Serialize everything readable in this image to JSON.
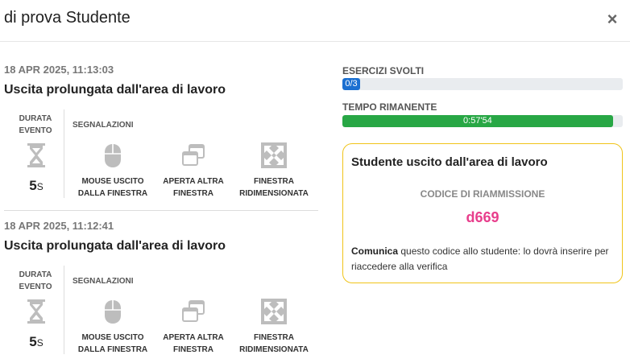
{
  "modal": {
    "title": "di prova Studente",
    "close_label": "×"
  },
  "events": [
    {
      "timestamp": "18 APR 2025, 11:13:03",
      "title": "Uscita prolungata dall'area di lavoro",
      "duration_label_line1": "DURATA",
      "duration_label_line2": "EVENTO",
      "duration_value": "5",
      "duration_unit": "S",
      "signals_label": "SEGNALAZIONI",
      "signals": [
        {
          "icon": "mouse-icon",
          "line1": "MOUSE USCITO",
          "line2": "DALLA FINESTRA"
        },
        {
          "icon": "windows-icon",
          "line1": "APERTA ALTRA",
          "line2": "FINESTRA"
        },
        {
          "icon": "resize-icon",
          "line1": "FINESTRA",
          "line2": "RIDIMENSIONATA"
        }
      ]
    },
    {
      "timestamp": "18 APR 2025, 11:12:41",
      "title": "Uscita prolungata dall'area di lavoro",
      "duration_label_line1": "DURATA",
      "duration_label_line2": "EVENTO",
      "duration_value": "5",
      "duration_unit": "S",
      "signals_label": "SEGNALAZIONI",
      "signals": [
        {
          "icon": "mouse-icon",
          "line1": "MOUSE USCITO",
          "line2": "DALLA FINESTRA"
        },
        {
          "icon": "windows-icon",
          "line1": "APERTA ALTRA",
          "line2": "FINESTRA"
        },
        {
          "icon": "resize-icon",
          "line1": "FINESTRA",
          "line2": "RIDIMENSIONATA"
        }
      ]
    }
  ],
  "progress": {
    "exercises_label": "ESERCIZI SVOLTI",
    "exercises_text": "0/3",
    "exercises_fraction": 0,
    "time_label": "TEMPO RIMANENTE",
    "time_text": "0:57'54",
    "time_fraction": 0.965
  },
  "alert_card": {
    "title": "Studente uscito dall'area di lavoro",
    "code_label": "CODICE DI RIAMMISSIONE",
    "code": "d669",
    "message_bold": "Comunica",
    "message_rest": " questo codice allo studente: lo dovrà inserire per riaccedere alla verifica"
  },
  "colors": {
    "accent_blue": "#1a6fd1",
    "success_green": "#28a745",
    "card_border_yellow": "#f0c419",
    "code_pink": "#e83e8c",
    "icon_gray": "#bdbdbd"
  }
}
